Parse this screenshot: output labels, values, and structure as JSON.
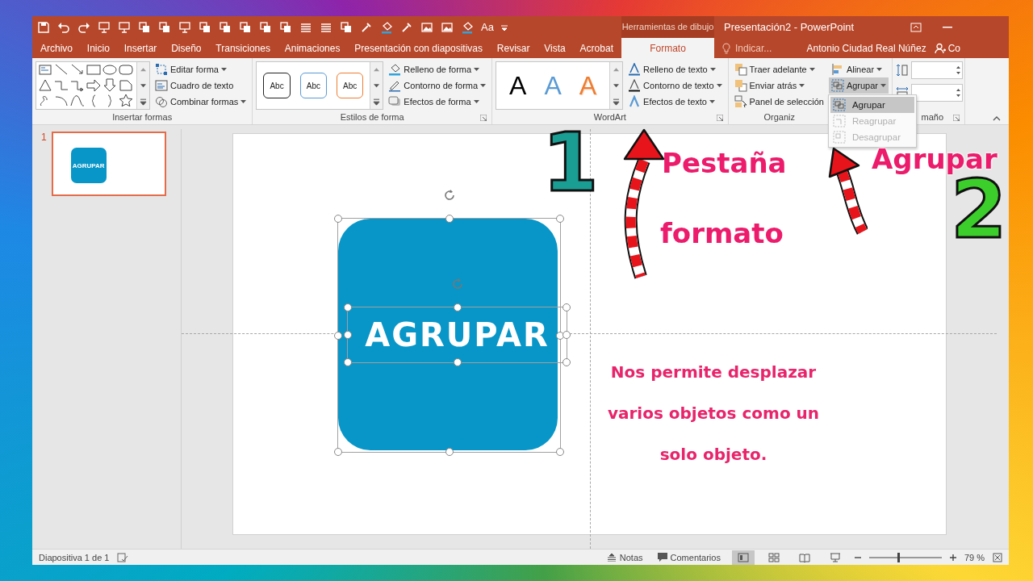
{
  "window": {
    "title": "Presentación2 - PowerPoint",
    "context_label": "Herramientas de dibujo",
    "qat_text": "Aa"
  },
  "tabs": [
    {
      "label": "Archivo",
      "kind": "standard",
      "selected": false
    },
    {
      "label": "Inicio",
      "kind": "standard",
      "selected": false
    },
    {
      "label": "Insertar",
      "kind": "standard",
      "selected": false
    },
    {
      "label": "Diseño",
      "kind": "standard",
      "selected": false
    },
    {
      "label": "Transiciones",
      "kind": "standard",
      "selected": false
    },
    {
      "label": "Animaciones",
      "kind": "standard",
      "selected": false
    },
    {
      "label": "Presentación con diapositivas",
      "kind": "standard",
      "selected": false
    },
    {
      "label": "Revisar",
      "kind": "standard",
      "selected": false
    },
    {
      "label": "Vista",
      "kind": "standard",
      "selected": false
    },
    {
      "label": "Acrobat",
      "kind": "standard",
      "selected": false
    },
    {
      "label": "Formato",
      "kind": "contextual",
      "selected": true
    }
  ],
  "tell_me": {
    "placeholder": "Indicar..."
  },
  "user": {
    "name": "Antonio Ciudad Real Núñez",
    "share": "Co"
  },
  "ribbon": {
    "insert_shapes": {
      "label": "Insertar formas",
      "buttons": [
        {
          "label": "Editar forma",
          "dropdown": true
        },
        {
          "label": "Cuadro de texto",
          "dropdown": false
        },
        {
          "label": "Combinar formas",
          "dropdown": true
        }
      ]
    },
    "shape_styles": {
      "label": "Estilos de forma",
      "swatches": [
        {
          "text": "Abc",
          "color": "#222222"
        },
        {
          "text": "Abc",
          "color": "#5b9bd5"
        },
        {
          "text": "Abc",
          "color": "#ed7d31"
        }
      ],
      "buttons": [
        {
          "label": "Relleno de forma",
          "dropdown": true
        },
        {
          "label": "Contorno de forma",
          "dropdown": true
        },
        {
          "label": "Efectos de forma",
          "dropdown": true
        }
      ]
    },
    "wordart": {
      "label": "WordArt",
      "styles": [
        {
          "text": "A",
          "kind": "fill",
          "color": "#000000"
        },
        {
          "text": "A",
          "kind": "fill",
          "color": "#5b9bd5"
        },
        {
          "text": "A",
          "kind": "outline",
          "color": "#ed7d31"
        }
      ],
      "buttons": [
        {
          "label": "Relleno de texto",
          "dropdown": true
        },
        {
          "label": "Contorno de texto",
          "dropdown": true
        },
        {
          "label": "Efectos de texto",
          "dropdown": true
        }
      ]
    },
    "arrange": {
      "label": "Organiz",
      "buttons": [
        {
          "label": "Traer adelante",
          "dropdown": true
        },
        {
          "label": "Enviar atrás",
          "dropdown": true
        },
        {
          "label": "Panel de selección",
          "dropdown": false
        }
      ],
      "align": {
        "label": "Alinear",
        "dropdown": true
      },
      "group": {
        "label": "Agrupar",
        "dropdown": true,
        "expanded": true
      },
      "menu": [
        {
          "label": "Agrupar",
          "selected": true,
          "disabled": false
        },
        {
          "label": "Reagrupar",
          "selected": false,
          "disabled": true
        },
        {
          "label": "Desagrupar",
          "selected": false,
          "disabled": true
        }
      ]
    },
    "size": {
      "label": "maño"
    }
  },
  "thumbnails": [
    {
      "number": "1",
      "text": "AGRUPAR",
      "selected": true
    }
  ],
  "slide": {
    "shape_text": "AGRUPAR",
    "selected": true,
    "note_lines": [
      "Nos permite desplazar",
      "varios objetos como un",
      "solo objeto."
    ]
  },
  "annotations": [
    {
      "kind": "number",
      "text": "1",
      "color": "#1a9e94"
    },
    {
      "kind": "label",
      "text": "Pestaña",
      "color": "#ec1b6b"
    },
    {
      "kind": "label",
      "text": "formato",
      "color": "#ec1b6b"
    },
    {
      "kind": "label",
      "text": "Agrupar",
      "color": "#ec1b6b"
    },
    {
      "kind": "number",
      "text": "2",
      "color": "#3ccf2b"
    }
  ],
  "status_bar": {
    "slide_info": "Diapositiva 1 de 1",
    "notes": "Notas",
    "comments": "Comentarios",
    "views": [
      {
        "kind": "normal",
        "selected": true
      },
      {
        "kind": "sorter",
        "selected": false
      },
      {
        "kind": "reading",
        "selected": false
      },
      {
        "kind": "slideshow",
        "selected": false
      }
    ],
    "zoom": {
      "level": 0.4,
      "reading": "79 %"
    }
  }
}
